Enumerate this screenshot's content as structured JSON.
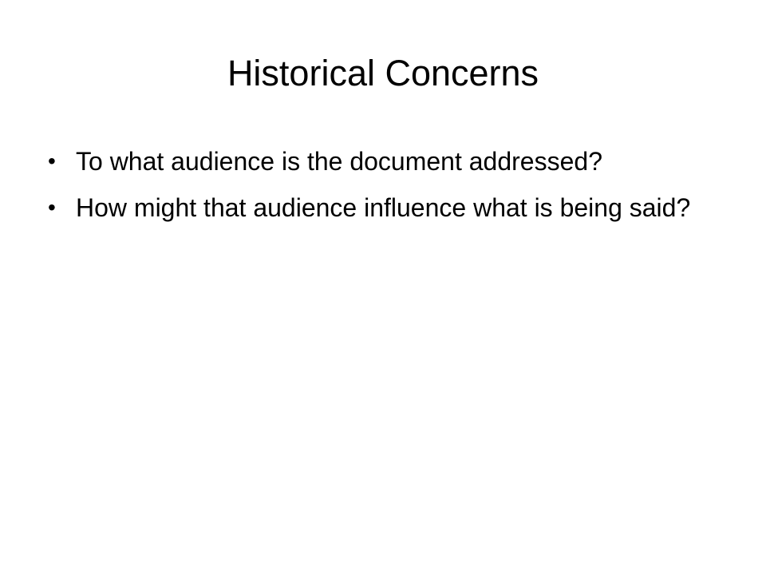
{
  "slide": {
    "title": "Historical Concerns",
    "bullets": [
      {
        "marker": "•",
        "text": "To what audience is the document addressed?"
      },
      {
        "marker": "•",
        "text": "How might that audience influence what is being said?"
      }
    ]
  }
}
